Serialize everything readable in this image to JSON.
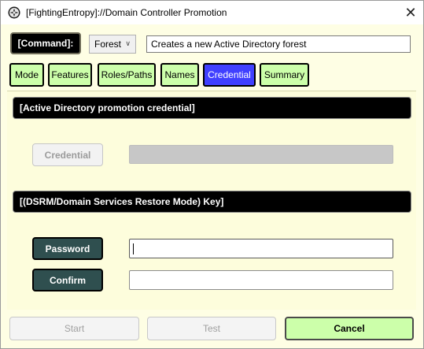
{
  "window": {
    "title": "[FightingEntropy]://Domain Controller Promotion",
    "icon": "fightingentropy-logo-icon",
    "close_glyph": "✕"
  },
  "command": {
    "label": "[Command]:",
    "selected": "Forest",
    "description": "Creates a new Active Directory forest"
  },
  "tabs": [
    {
      "label": "Mode",
      "active": false
    },
    {
      "label": "Features",
      "active": false
    },
    {
      "label": "Roles/Paths",
      "active": false
    },
    {
      "label": "Names",
      "active": false
    },
    {
      "label": "Credential",
      "active": true
    },
    {
      "label": "Summary",
      "active": false
    }
  ],
  "credential_section": {
    "header": "[Active Directory promotion credential]",
    "button_label": "Credential",
    "field_value": ""
  },
  "dsrm_section": {
    "header": "[(DSRM/Domain Services Restore Mode) Key]",
    "password_label": "Password",
    "password_value": "",
    "confirm_label": "Confirm",
    "confirm_value": ""
  },
  "footer": {
    "start_label": "Start",
    "test_label": "Test",
    "cancel_label": "Cancel"
  },
  "colors": {
    "tab_background": "#ccffaa",
    "tab_active": "#4040ff",
    "panel_background": "#fefee4",
    "dark_button": "#2f4f4f",
    "header_background": "#000000"
  }
}
